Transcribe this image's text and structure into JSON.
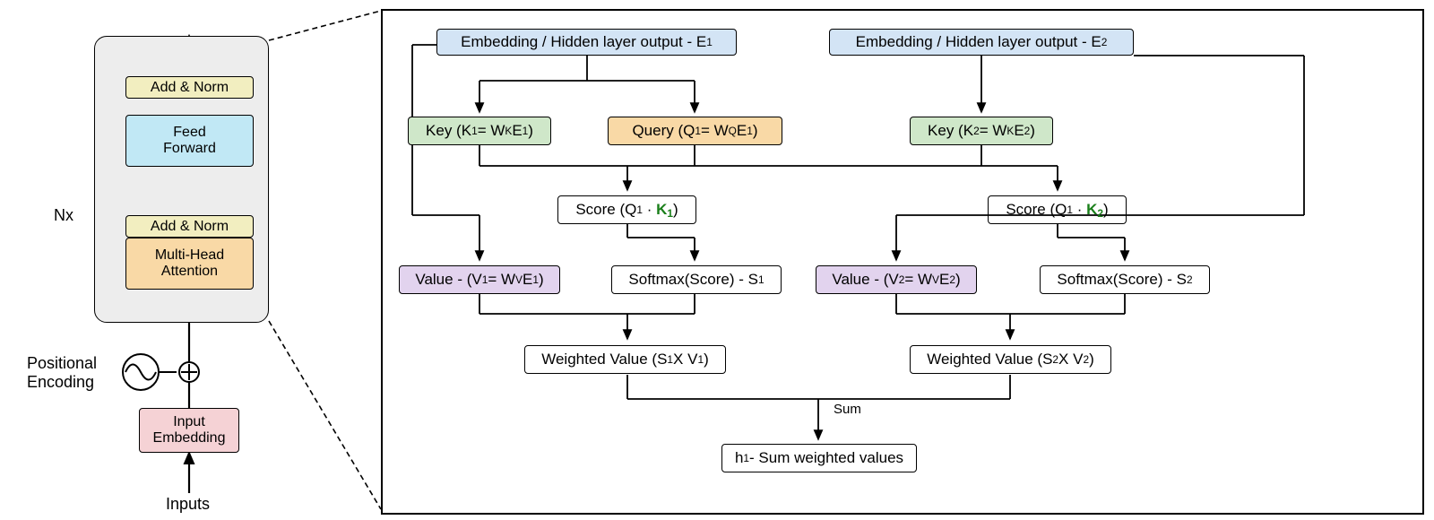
{
  "left": {
    "nx": "Nx",
    "add_norm1": "Add & Norm",
    "feed_forward": "Feed\nForward",
    "add_norm2": "Add & Norm",
    "mha": "Multi-Head\nAttention",
    "pos_enc": "Positional\nEncoding",
    "input_emb": "Input\nEmbedding",
    "inputs": "Inputs"
  },
  "detail": {
    "emb1": "Embedding / Hidden layer output - E",
    "emb1_sub": "1",
    "emb2": "Embedding / Hidden layer output  - E",
    "emb2_sub": "2",
    "key1": "Key (K",
    "key1_end": " = W",
    "key1_sup": "K",
    "key1_e": "E",
    "key1_sub": "1",
    "query1": "Query (Q",
    "query1_end": " = W",
    "query1_sup": "Q",
    "query1_e": "E",
    "query1_sub": "1",
    "key2": "Key (K",
    "key2_end": " = W",
    "key2_sup": "K",
    "key2_e": "E",
    "key2_sub": "2",
    "score1": "Score (Q",
    "score1_k": "K",
    "score1_ksub": "1",
    "score2": "Score (Q",
    "score2_k": "K",
    "score2_ksub": "2",
    "value1": "Value - (V",
    "value1_end": " = W",
    "value1_sup": "V",
    "value1_e": "E",
    "value1_sub": "1",
    "value2": "Value - (V",
    "value2_end": " = W",
    "value2_sup": "V",
    "value2_e": "E",
    "value2_sub": "2",
    "softmax1": "Softmax(Score) - S",
    "softmax1_sub": "1",
    "softmax2": "Softmax(Score) - S",
    "softmax2_sub": "2",
    "wv1_a": "Weighted Value (S",
    "wv1_x": " X V",
    "wv2_a": "Weighted Value (S",
    "wv2_x": " X V",
    "sum_label": "Sum",
    "h1": "h",
    "h1_text": " - Sum weighted values"
  },
  "colors": {
    "blue": "#c1e8f5",
    "yel": "#f2eec0",
    "orange": "#f9d9a6",
    "pink": "#f5d2d5",
    "gray": "#ededed",
    "green": "#cfe7c9",
    "purple": "#e2d3ee",
    "lblue": "#d3e4f5"
  }
}
